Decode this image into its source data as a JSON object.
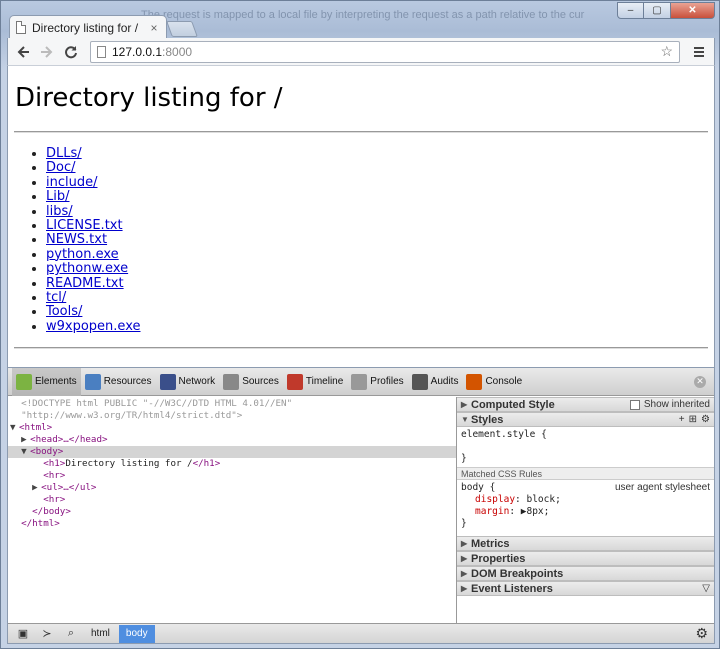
{
  "browser": {
    "background_text": "The request is mapped to a local file by interpreting the request as a path relative to the cur",
    "tab_title": "Directory listing for /",
    "tab_close": "×",
    "url_host": "127.0.0.1",
    "url_port": ":8000",
    "window_buttons": {
      "minimize": "–",
      "maximize": "▢",
      "close": "✕"
    }
  },
  "page": {
    "heading": "Directory listing for /",
    "entries": [
      "DLLs/",
      "Doc/",
      "include/",
      "Lib/",
      "libs/",
      "LICENSE.txt",
      "NEWS.txt",
      "python.exe",
      "pythonw.exe",
      "README.txt",
      "tcl/",
      "Tools/",
      "w9xpopen.exe"
    ]
  },
  "devtools": {
    "tabs": [
      {
        "label": "Elements",
        "icon": "elements-icon",
        "color": "#7cb342"
      },
      {
        "label": "Resources",
        "icon": "resources-icon",
        "color": "#4a7fc1"
      },
      {
        "label": "Network",
        "icon": "network-icon",
        "color": "#3a4f8a"
      },
      {
        "label": "Sources",
        "icon": "sources-icon",
        "color": "#888888"
      },
      {
        "label": "Timeline",
        "icon": "timeline-icon",
        "color": "#c0392b"
      },
      {
        "label": "Profiles",
        "icon": "profiles-icon",
        "color": "#999999"
      },
      {
        "label": "Audits",
        "icon": "audits-icon",
        "color": "#555555"
      },
      {
        "label": "Console",
        "icon": "console-icon",
        "color": "#d35400"
      }
    ],
    "dom": {
      "doctype_1": "<!DOCTYPE html PUBLIC \"-//W3C//DTD HTML 4.01//EN\"",
      "doctype_2": "\"http://www.w3.org/TR/html4/strict.dtd\">",
      "html_open": "<html>",
      "head": "<head>…</head>",
      "body_open": "<body>",
      "h1_open": "<h1>",
      "h1_text": "Directory listing for /",
      "h1_close": "</h1>",
      "hr1": "<hr>",
      "ul": "<ul>…</ul>",
      "hr2": "<hr>",
      "body_close": "</body>",
      "html_close": "</html>"
    },
    "sidebar": {
      "computed_style": "Computed Style",
      "show_inherited": "Show inherited",
      "styles": "Styles",
      "element_style_open": "element.style {",
      "close_brace": "}",
      "matched_rules": "Matched CSS Rules",
      "body_rule_open": "body {",
      "user_agent": "user agent stylesheet",
      "prop1_name": "display",
      "prop1_value": ": block;",
      "prop2_name": "margin",
      "prop2_value": ": ▶8px;",
      "metrics": "Metrics",
      "properties": "Properties",
      "dom_breakpoints": "DOM Breakpoints",
      "event_listeners": "Event Listeners"
    },
    "breadcrumbs": [
      "html",
      "body"
    ]
  }
}
